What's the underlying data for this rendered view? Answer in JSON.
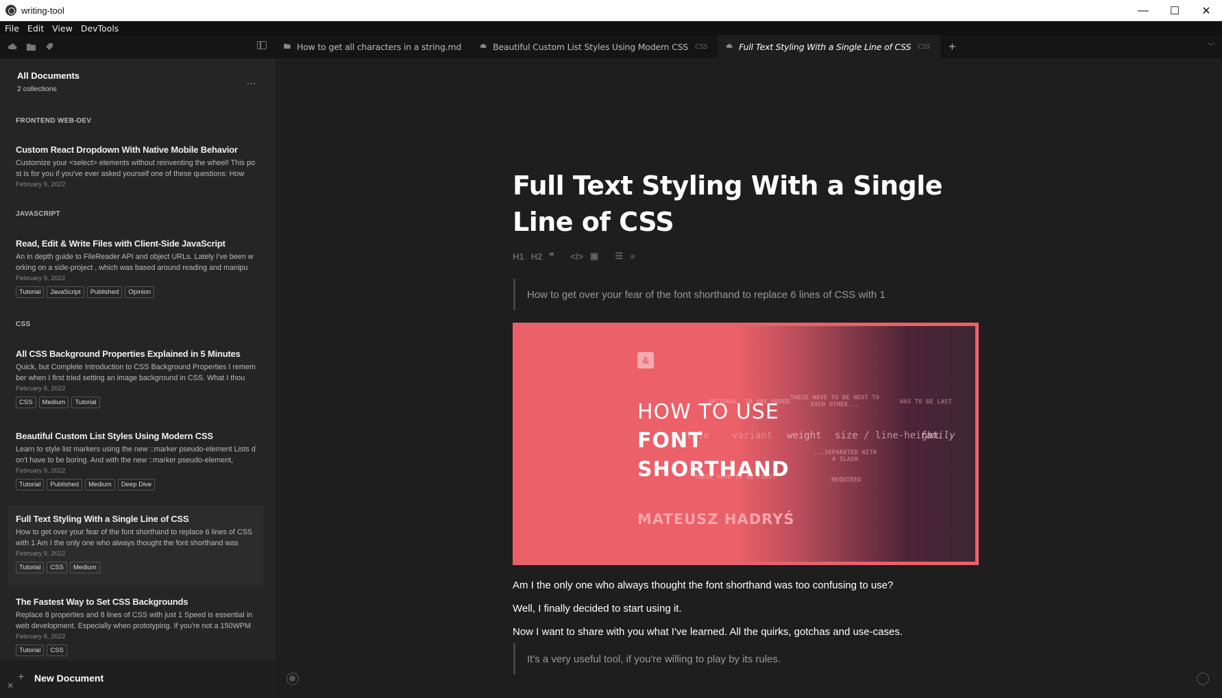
{
  "window": {
    "title": "writing-tool",
    "minimize": "—",
    "maximize": "☐",
    "close": "✕"
  },
  "menu": [
    "File",
    "Edit",
    "View",
    "DevTools"
  ],
  "tabs": [
    {
      "label": "How to get all characters in a string.md",
      "tag": "",
      "icon": "folder-icon"
    },
    {
      "label": "Beautiful Custom List Styles Using Modern CSS",
      "tag": "CSS",
      "icon": "cloud-icon"
    },
    {
      "label": "Full Text Styling With a Single Line of CSS",
      "tag": "CSS",
      "icon": "cloud-icon",
      "active": true
    }
  ],
  "tab_add": "+",
  "sidebar": {
    "title": "All Documents",
    "subtitle": "2 collections",
    "more": "...",
    "groups": [
      "FRONTEND WEB-DEV",
      "JAVASCRIPT",
      "CSS"
    ],
    "docs": [
      {
        "title": "Custom React Dropdown With Native Mobile Behavior",
        "excerpt": "Customize your <select> elements without reinventing the wheel! This post is for you if you've ever asked yourself one of these questions: How",
        "date": "February 9, 2022",
        "tags": []
      },
      {
        "title": "Read, Edit & Write Files with Client-Side JavaScript",
        "excerpt": "An in depth guide to FileReader API and object URLs. Lately I've been working on a  side-project , which was based around reading and manipu",
        "date": "February 9, 2022",
        "tags": [
          "Tutorial",
          "JavaScript",
          "Published",
          "Opinion"
        ]
      },
      {
        "title": "All CSS Background Properties Explained in 5 Minutes",
        "excerpt": "Quick, but Complete Introduction to CSS Background Properties I remember when I first tried setting an image background in CSS. What I thou",
        "date": "February 8, 2022",
        "tags": [
          "CSS",
          "Medium",
          "Tutorial"
        ]
      },
      {
        "title": "Beautiful Custom List Styles Using Modern CSS",
        "excerpt": "Learn to style list markers using the new ::marker pseudo-element Lists don't have to be boring. And with the new  ::marker  pseudo-element,",
        "date": "February 9, 2022",
        "tags": [
          "Tutorial",
          "Published",
          "Medium",
          "Deep Dive"
        ]
      },
      {
        "title": "Full Text Styling With a Single Line of CSS",
        "excerpt": "How to get over your fear of the font shorthand to replace 6 lines of CSS with 1 Am I the only one who always thought the font shorthand was",
        "date": "February 9, 2022",
        "tags": [
          "Tutorial",
          "CSS",
          "Medium"
        ]
      },
      {
        "title": "The Fastest Way to Set CSS Backgrounds",
        "excerpt": "Replace 8 properties and 8 lines of CSS with just 1 Speed is essential in web development. Especially when prototyping. If you're not a 150WPM",
        "date": "February 8, 2022",
        "tags": [
          "Tutorial",
          "CSS"
        ]
      }
    ],
    "new_document": "New Document"
  },
  "document": {
    "title": "Full Text Styling With a Single Line of CSS",
    "subtitle": "How to get over your fear of the font shorthand to replace 6 lines of CSS with 1",
    "toolbar": [
      "H1",
      "H2",
      "❝",
      "</>",
      "▣",
      "☰",
      "≡"
    ],
    "hero": {
      "logo": "&",
      "line1": "HOW TO USE",
      "line2": "FONT",
      "line3": "SHORTHAND",
      "author": "MATEUSZ HADRYŚ",
      "diagram": [
        "style",
        "variant",
        "weight",
        "size / line-height",
        "family"
      ],
      "notes": [
        "THESE HAVE TO BE NEXT TO EACH OTHER...",
        "HAS TO BE LAST",
        "...SEPARATED WITH A SLASH",
        "REQUIRED",
        "THESE HAVE TO BE FIRST",
        "OPTIONAL, IN ANY ORDER"
      ]
    },
    "paragraphs": [
      "Am I the only one who always thought the font shorthand was too confusing to use?",
      "Well, I finally decided to start using it.",
      "Now I want to share with you what I've learned. All the quirks, gotchas and use-cases."
    ],
    "quote": "It's a very useful tool, if you're willing to play by its rules."
  }
}
